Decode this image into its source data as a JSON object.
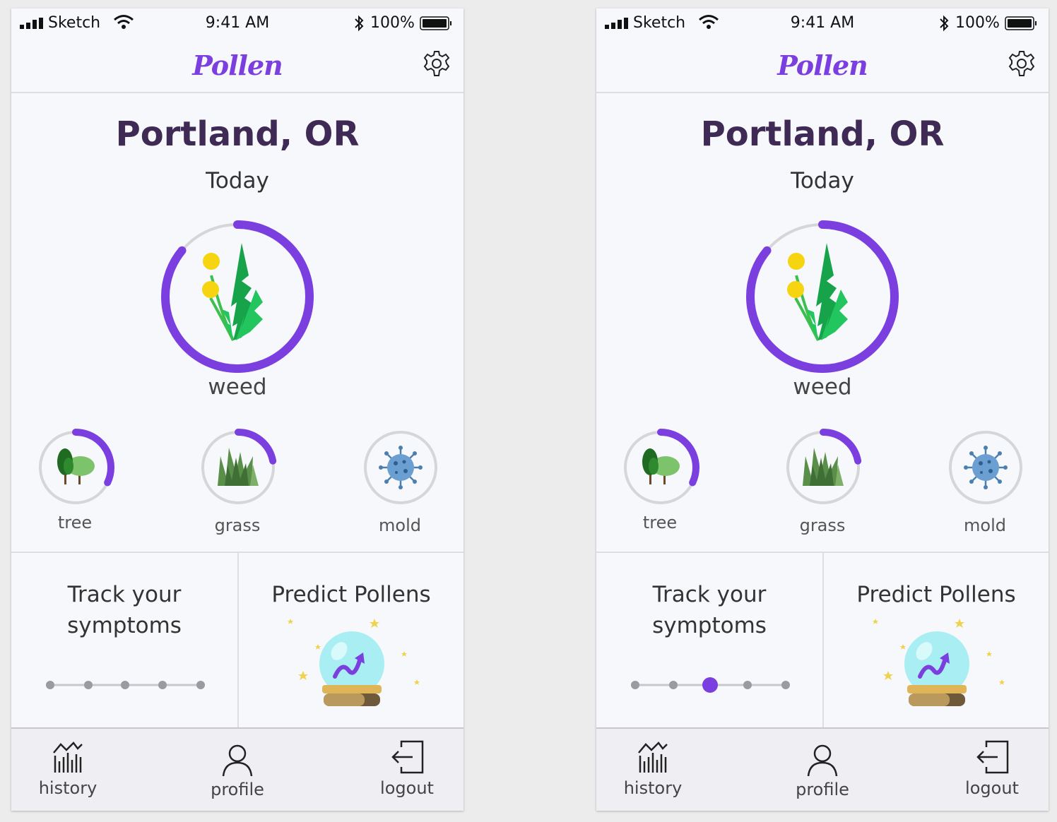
{
  "screens": [
    {
      "id": "left",
      "status": {
        "carrier": "Sketch",
        "time": "9:41 AM",
        "battery": "100%"
      },
      "app_title": "Pollen",
      "location": "Portland, OR",
      "day": "Today",
      "main_pollen": {
        "label": "weed",
        "level": 0.86,
        "icon": "weed-icon"
      },
      "pollens": [
        {
          "label": "tree",
          "level": 0.32,
          "icon": "tree-icon"
        },
        {
          "label": "grass",
          "level": 0.22,
          "icon": "grass-icon"
        },
        {
          "label": "mold",
          "level": 0,
          "icon": "virus-icon"
        }
      ],
      "cards": {
        "track": [
          "Track your",
          "symptoms"
        ],
        "predict": "Predict Pollens"
      },
      "symptom_slider": {
        "steps": 5,
        "selected": null
      },
      "tabs": [
        {
          "label": "history",
          "icon": "chart-icon"
        },
        {
          "label": "profile",
          "icon": "person-icon"
        },
        {
          "label": "logout",
          "icon": "logout-icon"
        }
      ],
      "colors": {
        "accent": "#7b3fe0",
        "title": "#3f2a56",
        "ring_track": "#d6d6d9"
      }
    },
    {
      "id": "right",
      "status": {
        "carrier": "Sketch",
        "time": "9:41 AM",
        "battery": "100%"
      },
      "app_title": "Pollen",
      "location": "Portland, OR",
      "day": "Today",
      "main_pollen": {
        "label": "weed",
        "level": 0.86,
        "icon": "weed-icon"
      },
      "pollens": [
        {
          "label": "tree",
          "level": 0.32,
          "icon": "tree-icon"
        },
        {
          "label": "grass",
          "level": 0.22,
          "icon": "grass-icon"
        },
        {
          "label": "mold",
          "level": 0,
          "icon": "virus-icon"
        }
      ],
      "cards": {
        "track": [
          "Track your",
          "symptoms"
        ],
        "predict": "Predict Pollens"
      },
      "symptom_slider": {
        "steps": 5,
        "selected": 2
      },
      "tabs": [
        {
          "label": "history",
          "icon": "chart-icon"
        },
        {
          "label": "profile",
          "icon": "person-icon"
        },
        {
          "label": "logout",
          "icon": "logout-icon"
        }
      ],
      "colors": {
        "accent": "#7b3fe0",
        "title": "#3f2a56",
        "ring_track": "#d6d6d9"
      }
    }
  ]
}
